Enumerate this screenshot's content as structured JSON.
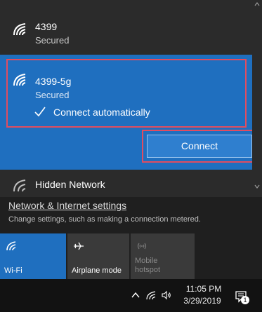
{
  "networks": [
    {
      "name": "4399",
      "status": "Secured"
    },
    {
      "name": "4399-5g",
      "status": "Secured",
      "auto_label": "Connect automatically",
      "button_label": "Connect"
    }
  ],
  "hidden_network": {
    "name": "Hidden Network"
  },
  "settings": {
    "link": "Network & Internet settings",
    "description": "Change settings, such as making a connection metered."
  },
  "quick_actions": {
    "wifi": "Wi-Fi",
    "airplane": "Airplane mode",
    "hotspot_line1": "Mobile",
    "hotspot_line2": "hotspot"
  },
  "taskbar": {
    "time": "11:05 PM",
    "date": "3/29/2019",
    "notification_count": "1"
  },
  "colors": {
    "accent": "#1f6fbf",
    "highlight": "#e14d60"
  },
  "icons": [
    "wifi-icon",
    "checkmark-icon",
    "airplane-icon",
    "hotspot-icon",
    "chevron-up-icon",
    "network-icon",
    "volume-icon",
    "notification-icon"
  ]
}
